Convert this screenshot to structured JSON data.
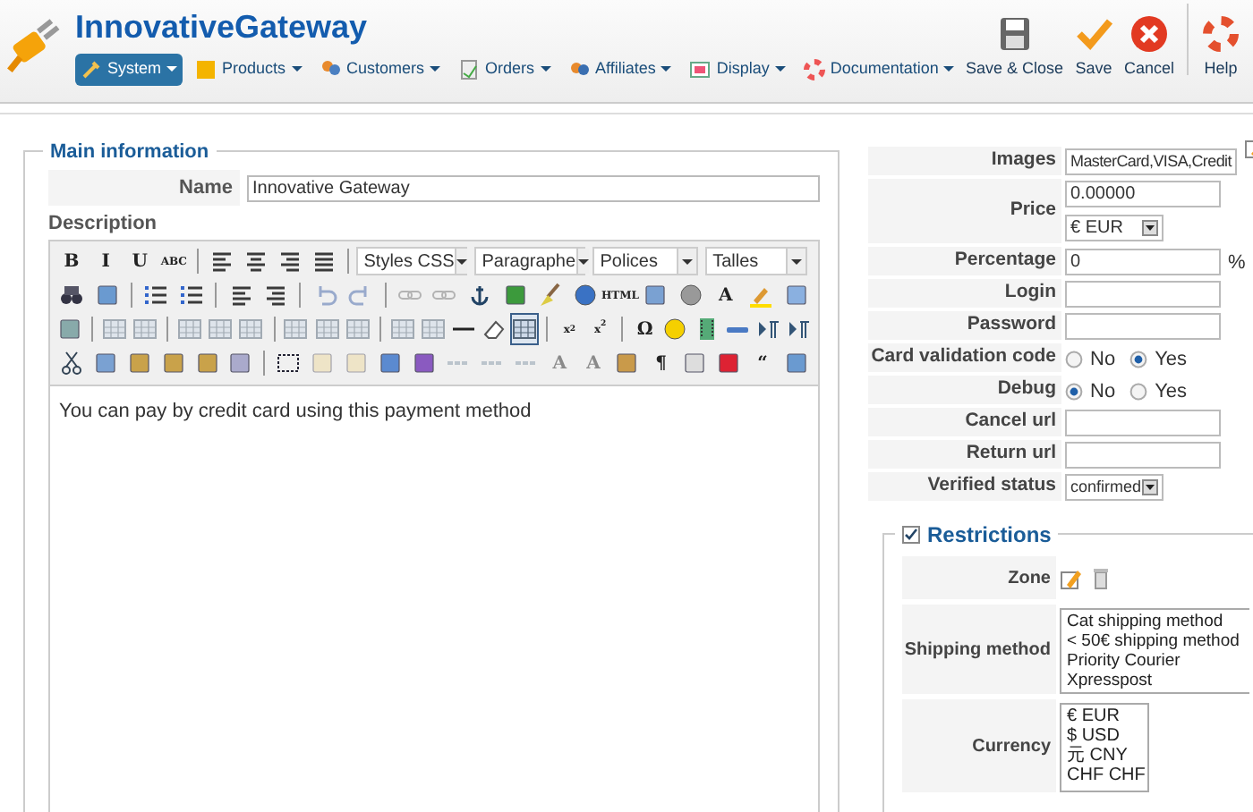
{
  "header": {
    "title": "InnovativeGateway",
    "menu": [
      {
        "label": "System",
        "selected": true
      },
      {
        "label": "Products",
        "selected": false
      },
      {
        "label": "Customers",
        "selected": false
      },
      {
        "label": "Orders",
        "selected": false
      },
      {
        "label": "Affiliates",
        "selected": false
      },
      {
        "label": "Display",
        "selected": false
      },
      {
        "label": "Documentation",
        "selected": false
      }
    ],
    "actions": [
      {
        "label": "Save & Close"
      },
      {
        "label": "Save"
      },
      {
        "label": "Cancel"
      },
      {
        "label": "Help"
      }
    ]
  },
  "main": {
    "legend": "Main information",
    "name_label": "Name",
    "name_value": "Innovative Gateway",
    "description_label": "Description",
    "toolbar": [
      [
        {
          "kind": "text",
          "label": "B",
          "disabled": false
        },
        {
          "kind": "text",
          "label": "I",
          "disabled": false
        },
        {
          "kind": "text",
          "label": "U",
          "disabled": false
        },
        {
          "kind": "text",
          "label": "ABC",
          "disabled": false
        },
        {
          "kind": "sep"
        },
        {
          "kind": "icon",
          "disabled": false
        },
        {
          "kind": "icon",
          "disabled": false
        },
        {
          "kind": "icon",
          "disabled": false
        },
        {
          "kind": "icon",
          "disabled": false
        },
        {
          "kind": "sep"
        },
        {
          "kind": "select",
          "label": "Styles CSS"
        },
        {
          "kind": "select",
          "label": "Paragraphe"
        },
        {
          "kind": "select",
          "label": "Polices"
        },
        {
          "kind": "select",
          "label": "Talles"
        }
      ],
      [
        {
          "kind": "icon",
          "disabled": false
        },
        {
          "kind": "icon",
          "disabled": false
        },
        {
          "kind": "sep"
        },
        {
          "kind": "icon",
          "disabled": false
        },
        {
          "kind": "icon",
          "disabled": false
        },
        {
          "kind": "sep"
        },
        {
          "kind": "icon",
          "disabled": false
        },
        {
          "kind": "icon",
          "disabled": false
        },
        {
          "kind": "sep"
        },
        {
          "kind": "icon",
          "disabled": true
        },
        {
          "kind": "icon",
          "disabled": true
        },
        {
          "kind": "sep"
        },
        {
          "kind": "icon",
          "disabled": true
        },
        {
          "kind": "icon",
          "disabled": true
        },
        {
          "kind": "icon",
          "disabled": false
        },
        {
          "kind": "icon",
          "disabled": false
        },
        {
          "kind": "icon",
          "disabled": false
        },
        {
          "kind": "icon",
          "disabled": false
        },
        {
          "kind": "text",
          "label": "HTML",
          "disabled": false
        },
        {
          "kind": "icon",
          "disabled": false
        },
        {
          "kind": "icon",
          "disabled": false
        },
        {
          "kind": "text",
          "label": "A",
          "disabled": false
        },
        {
          "kind": "icon",
          "disabled": false
        },
        {
          "kind": "icon",
          "disabled": false
        }
      ],
      [
        {
          "kind": "icon",
          "disabled": false
        },
        {
          "kind": "sep"
        },
        {
          "kind": "icon",
          "disabled": true
        },
        {
          "kind": "icon",
          "disabled": true
        },
        {
          "kind": "sep"
        },
        {
          "kind": "icon",
          "disabled": true
        },
        {
          "kind": "icon",
          "disabled": true
        },
        {
          "kind": "icon",
          "disabled": true
        },
        {
          "kind": "sep"
        },
        {
          "kind": "icon",
          "disabled": true
        },
        {
          "kind": "icon",
          "disabled": true
        },
        {
          "kind": "icon",
          "disabled": true
        },
        {
          "kind": "sep"
        },
        {
          "kind": "icon",
          "disabled": true
        },
        {
          "kind": "icon",
          "disabled": true
        },
        {
          "kind": "icon",
          "disabled": false
        },
        {
          "kind": "icon",
          "disabled": false
        },
        {
          "kind": "icon",
          "disabled": false,
          "selected": true
        },
        {
          "kind": "sep"
        },
        {
          "kind": "text",
          "label": "x$_{2}$",
          "disabled": false
        },
        {
          "kind": "text",
          "label": "x$^{2}$",
          "disabled": false
        },
        {
          "kind": "sep"
        },
        {
          "kind": "text",
          "label": "Ω",
          "disabled": false
        },
        {
          "kind": "icon",
          "disabled": false
        },
        {
          "kind": "icon",
          "disabled": false
        },
        {
          "kind": "icon",
          "disabled": false
        },
        {
          "kind": "icon",
          "disabled": false
        },
        {
          "kind": "icon",
          "disabled": false
        }
      ],
      [
        {
          "kind": "icon",
          "disabled": false
        },
        {
          "kind": "icon",
          "disabled": false
        },
        {
          "kind": "icon",
          "disabled": false
        },
        {
          "kind": "icon",
          "disabled": false
        },
        {
          "kind": "icon",
          "disabled": false
        },
        {
          "kind": "icon",
          "disabled": false
        },
        {
          "kind": "sep"
        },
        {
          "kind": "icon",
          "disabled": false
        },
        {
          "kind": "icon",
          "disabled": true
        },
        {
          "kind": "icon",
          "disabled": true
        },
        {
          "kind": "icon",
          "disabled": false
        },
        {
          "kind": "icon",
          "disabled": false
        },
        {
          "kind": "icon",
          "disabled": true
        },
        {
          "kind": "icon",
          "disabled": true
        },
        {
          "kind": "icon",
          "disabled": true
        },
        {
          "kind": "text",
          "label": "A",
          "disabled": true
        },
        {
          "kind": "text",
          "label": "A",
          "disabled": true
        },
        {
          "kind": "icon",
          "disabled": false
        },
        {
          "kind": "text",
          "label": "¶",
          "disabled": false
        },
        {
          "kind": "icon",
          "disabled": false
        },
        {
          "kind": "icon",
          "disabled": false
        },
        {
          "kind": "text",
          "label": "“",
          "disabled": false
        },
        {
          "kind": "icon",
          "disabled": false
        }
      ]
    ],
    "body": "You can pay by credit card using this payment method"
  },
  "fields": [
    {
      "kind": "text",
      "label": "Images",
      "value": "MasterCard,VISA,Credit",
      "edit_icon": true
    },
    {
      "kind": "price",
      "label": "Price",
      "value": "0.00000",
      "currency": "€ EUR"
    },
    {
      "kind": "text",
      "label": "Percentage",
      "value": "0",
      "suffix": "%"
    },
    {
      "kind": "text",
      "label": "Login"
    },
    {
      "kind": "text",
      "label": "Password"
    },
    {
      "kind": "radio",
      "label": "Card validation code",
      "options": [
        {
          "label": "No",
          "selected": false
        },
        {
          "label": "Yes",
          "selected": true
        }
      ]
    },
    {
      "kind": "radio",
      "label": "Debug",
      "options": [
        {
          "label": "No",
          "selected": true
        },
        {
          "label": "Yes",
          "selected": false
        }
      ]
    },
    {
      "kind": "text",
      "label": "Cancel url"
    },
    {
      "kind": "text",
      "label": "Return url"
    },
    {
      "kind": "select",
      "label": "Verified status",
      "value": "confirmed"
    }
  ],
  "restrictions": {
    "checked": true,
    "title": "Restrictions",
    "rows": [
      {
        "kind": "zone",
        "label": "Zone"
      },
      {
        "kind": "list",
        "label": "Shipping method",
        "items": [
          "Cat shipping method",
          "< 50€ shipping method",
          "Priority Courier",
          "Xpresspost"
        ]
      },
      {
        "kind": "scroll_list",
        "label": "Currency",
        "items": [
          "€ EUR",
          "$ USD",
          "元 CNY",
          "CHF CHF"
        ]
      }
    ]
  }
}
